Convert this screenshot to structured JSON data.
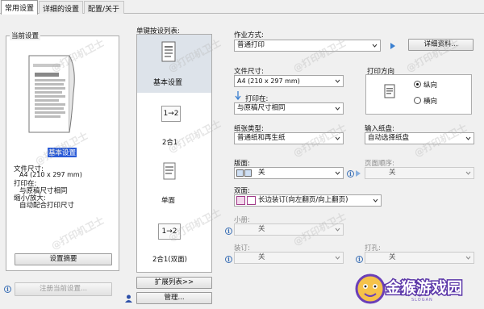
{
  "tabs": [
    "常用设置",
    "详细的设置",
    "配置/关于"
  ],
  "current_settings": {
    "title": "当前设置",
    "preview_caption": "基本设置",
    "doc_size_label": "文件尺寸:",
    "doc_size_value": "A4 (210 x 297 mm)",
    "print_on_label": "打印在:",
    "print_on_value": "与原稿尺寸相同",
    "zoom_label": "缩小/放大:",
    "zoom_value": "自动配合打印尺寸",
    "summary_button": "设置摘要",
    "register_button": "注册当前设置..."
  },
  "one_click": {
    "title": "单键按设列表:",
    "items": [
      {
        "label": "基本设置",
        "selected": true,
        "icon": "document-icon"
      },
      {
        "label": "2合1",
        "selected": false,
        "icon": "two-in-one-icon",
        "badge": "1→2"
      },
      {
        "label": "单面",
        "selected": false,
        "icon": "single-side-icon"
      },
      {
        "label": "2合1(双面)",
        "selected": false,
        "icon": "two-in-one-duplex-icon",
        "badge": "1→2"
      }
    ],
    "expand_button": "扩展列表>>",
    "manage_button": "管理..."
  },
  "job": {
    "label": "作业方式:",
    "value": "普通打印",
    "details_button": "详细资料..."
  },
  "doc_size": {
    "label": "文件尺寸:",
    "value": "A4 (210 x 297 mm)"
  },
  "print_on": {
    "label": "打印在:",
    "value": "与原稿尺寸相同"
  },
  "orientation": {
    "label": "打印方向",
    "options": [
      {
        "label": "纵向",
        "checked": true
      },
      {
        "label": "横向",
        "checked": false
      }
    ]
  },
  "paper_type": {
    "label": "纸张类型:",
    "value": "普通纸和再生纸"
  },
  "input_tray": {
    "label": "输入纸盘:",
    "value": "自动选择纸盘"
  },
  "layout": {
    "label": "版面:",
    "value": "关"
  },
  "page_order": {
    "label": "页面顺序:",
    "value": "关"
  },
  "duplex": {
    "label": "双面:",
    "value": "长边装订(向左翻页/向上翻页)"
  },
  "booklet": {
    "label": "小册:",
    "value": "关"
  },
  "staple": {
    "label": "装订:",
    "value": "关"
  },
  "punch": {
    "label": "打孔:",
    "value": "关"
  },
  "watermark_text": "@打印机卫士",
  "brand": {
    "name": "金猴游戏园",
    "sub": "SLOGAN"
  }
}
